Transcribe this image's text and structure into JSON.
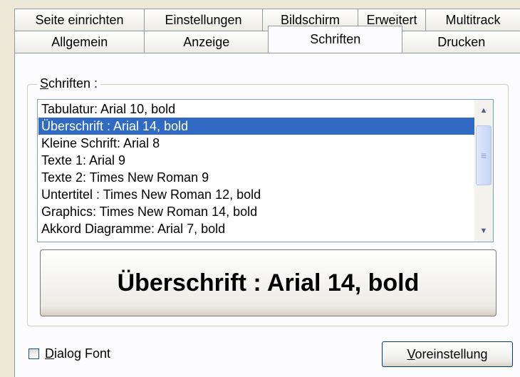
{
  "tabs_row1": [
    "Seite einrichten",
    "Einstellungen",
    "Bildschirm",
    "Erweitert",
    "Multitrack"
  ],
  "tabs_row2": [
    "Allgemein",
    "Anzeige",
    "Schriften",
    "Drucken"
  ],
  "active_tab": "Schriften",
  "group": {
    "label_mnemonic": "S",
    "label_rest": "chriften :"
  },
  "font_list": [
    "Tabulatur: Arial 10, bold",
    "Überschrift : Arial 14, bold",
    "Kleine Schrift: Arial 8",
    "Texte 1: Arial 9",
    "Texte 2: Times New Roman 9",
    "Untertitel : Times New Roman 12, bold",
    "Graphics: Times New Roman 14, bold",
    "Akkord Diagramme: Arial 7, bold"
  ],
  "selected_index": 1,
  "preview_text": "Überschrift : Arial 14, bold",
  "dialog_font": {
    "mnemonic": "D",
    "rest": "ialog Font",
    "checked": false
  },
  "default_button": {
    "mnemonic": "V",
    "rest": "oreinstellung"
  },
  "colors": {
    "selection": "#316ac5",
    "panel": "#fcfcfe",
    "border": "#919b9c"
  }
}
